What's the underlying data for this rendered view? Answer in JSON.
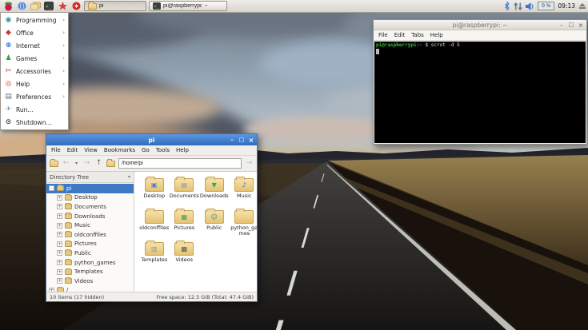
{
  "taskbar": {
    "launchers": [
      {
        "icon": "raspberry-menu-icon"
      },
      {
        "icon": "web-browser-icon"
      },
      {
        "icon": "file-manager-icon"
      },
      {
        "icon": "terminal-icon"
      },
      {
        "icon": "mathematica-icon"
      },
      {
        "icon": "wolfram-icon"
      }
    ],
    "windows": [
      {
        "label": "pi",
        "icon": "folder-icon",
        "active": true
      },
      {
        "label": "pi@raspberrypi: ~",
        "icon": "terminal-icon",
        "active": false
      }
    ],
    "tray": {
      "icons": [
        "bluetooth-icon",
        "network-arrows-icon",
        "volume-icon"
      ],
      "cpu": "0 %",
      "clock": "09:13",
      "eject": "eject-icon"
    }
  },
  "menu": {
    "items": [
      {
        "label": "Programming",
        "icon": "programming-icon",
        "has_submenu": true
      },
      {
        "label": "Office",
        "icon": "office-icon",
        "has_submenu": true
      },
      {
        "label": "Internet",
        "icon": "internet-icon",
        "has_submenu": true
      },
      {
        "label": "Games",
        "icon": "games-icon",
        "has_submenu": true
      },
      {
        "label": "Accessories",
        "icon": "accessories-icon",
        "has_submenu": true
      },
      {
        "label": "Help",
        "icon": "help-icon",
        "has_submenu": true
      },
      {
        "label": "Preferences",
        "icon": "preferences-icon",
        "has_submenu": true
      },
      {
        "label": "Run...",
        "icon": "run-icon",
        "has_submenu": false
      },
      {
        "label": "Shutdown...",
        "icon": "shutdown-icon",
        "has_submenu": false
      }
    ]
  },
  "file_manager": {
    "title": "pi",
    "menu_items": [
      "File",
      "Edit",
      "View",
      "Bookmarks",
      "Go",
      "Tools",
      "Help"
    ],
    "toolbar": {
      "path": "/home/pi"
    },
    "sidebar": {
      "mode": "Directory Tree",
      "items": [
        {
          "label": "pi",
          "selected": true
        },
        {
          "label": "Desktop"
        },
        {
          "label": "Documents"
        },
        {
          "label": "Downloads"
        },
        {
          "label": "Music"
        },
        {
          "label": "oldconffiles"
        },
        {
          "label": "Pictures"
        },
        {
          "label": "Public"
        },
        {
          "label": "python_games"
        },
        {
          "label": "Templates"
        },
        {
          "label": "Videos"
        },
        {
          "label": "/"
        }
      ]
    },
    "files": [
      {
        "name": "Desktop",
        "emblem": "desktop"
      },
      {
        "name": "Documents",
        "emblem": "documents"
      },
      {
        "name": "Downloads",
        "emblem": "downloads"
      },
      {
        "name": "Music",
        "emblem": "music"
      },
      {
        "name": "oldconffiles",
        "emblem": "none"
      },
      {
        "name": "Pictures",
        "emblem": "pictures"
      },
      {
        "name": "Public",
        "emblem": "public"
      },
      {
        "name": "python_games",
        "emblem": "none"
      },
      {
        "name": "Templates",
        "emblem": "templates"
      },
      {
        "name": "Videos",
        "emblem": "videos"
      }
    ],
    "status_left": "10 items (17 hidden)",
    "status_right": "Free space: 12.5 GiB (Total: 47.4 GiB)"
  },
  "terminal": {
    "title": "pi@raspberrypi: ~",
    "menu_items": [
      "File",
      "Edit",
      "Tabs",
      "Help"
    ],
    "prompt_user": "pi@raspberrypi",
    "prompt_separator": ":",
    "prompt_path": "~",
    "prompt_symbol": " $ ",
    "command": "scrot -d 5"
  }
}
